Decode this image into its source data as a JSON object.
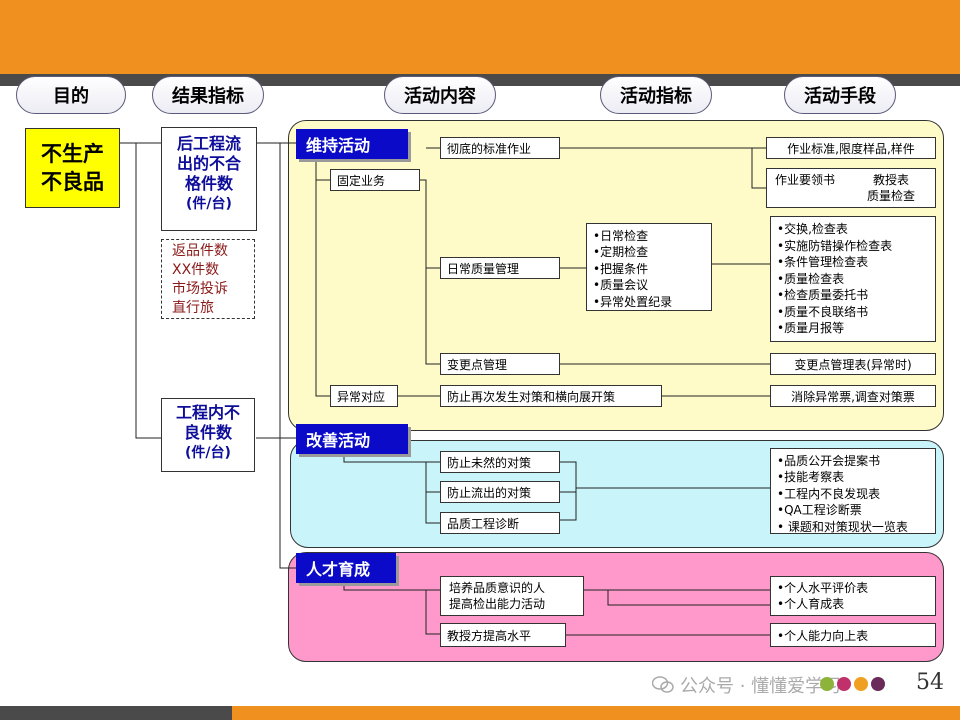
{
  "headers": {
    "purpose": "目的",
    "result_indicator": "结果指标",
    "activity_content": "活动内容",
    "activity_indicator": "活动指标",
    "activity_means": "活动手段"
  },
  "goal": {
    "line1": "不生产",
    "line2": "不良品"
  },
  "result_indicators": {
    "after_process": {
      "line1": "后工程流",
      "line2": "出的不合",
      "line3": "格件数",
      "unit": "(件/台)"
    },
    "market": {
      "line1": "返品件数",
      "line2": "XX件数",
      "line3": "市场投诉",
      "line4": "直行旅"
    },
    "in_process": {
      "line1": "工程内不",
      "line2": "良件数",
      "unit": "(件/台)"
    }
  },
  "sections": {
    "maintain": {
      "title": "维持活动",
      "fixed_work": "固定业务",
      "abnormal_response": "异常对应",
      "standard_work": "彻底的标准作业",
      "daily_qc": "日常质量管理",
      "change_point": "变更点管理",
      "prevent_recurrence": "防止再次发生对策和横向展开策",
      "daily_checks": [
        "•日常检查",
        "•定期检查",
        "•把握条件",
        "•质量会议",
        "•异常处置纪录"
      ],
      "means_standard": "作业标准,限度样品,样件",
      "means_guide_1": "作业要领书",
      "means_guide_2": "教授表",
      "means_guide_3": "质量检查",
      "means_daily": [
        "•交换,检查表",
        "•实施防错操作检查表",
        "•条件管理检查表",
        "•质量检查表",
        "•检查质量委托书",
        "•质量不良联络书",
        "•质量月报等"
      ],
      "means_change": "变更点管理表(异常时)",
      "means_abnormal": "消除异常票,调查对策票"
    },
    "improve": {
      "title": "改善活动",
      "prevent_occurrence": "防止未然的对策",
      "prevent_outflow": "防止流出的对策",
      "quality_diagnosis": "品质工程诊断",
      "means": [
        "•品质公开会提案书",
        "•技能考察表",
        "•工程内不良发现表",
        "•QA工程诊断票",
        "• 课题和对策现状一览表"
      ]
    },
    "talent": {
      "title": "人才育成",
      "activity_1_line1": "培养品质意识的人",
      "activity_1_line2": "提高检出能力活动",
      "activity_2": "教授方提高水平",
      "means_1": [
        "•个人水平评价表",
        "•个人育成表"
      ],
      "means_2": "•个人能力向上表"
    }
  },
  "footer": {
    "watermark": "公众号 · 懂懂爱学习",
    "page_number": "54"
  },
  "colors": {
    "top_bar": "#F0901E",
    "dark_stripe": "#4a4a4a",
    "maintain_panel": "#FFFBC8",
    "improve_panel": "#C8F4FA",
    "talent_panel": "#FF99CC",
    "section_header": "#0A0AC8",
    "goal_box": "#FFFF00",
    "indicator_text": "#0D0D9A",
    "market_text": "#8B1A1A",
    "dots": [
      "#8DB33A",
      "#C0306A",
      "#F0A020",
      "#6A2A5A"
    ]
  }
}
